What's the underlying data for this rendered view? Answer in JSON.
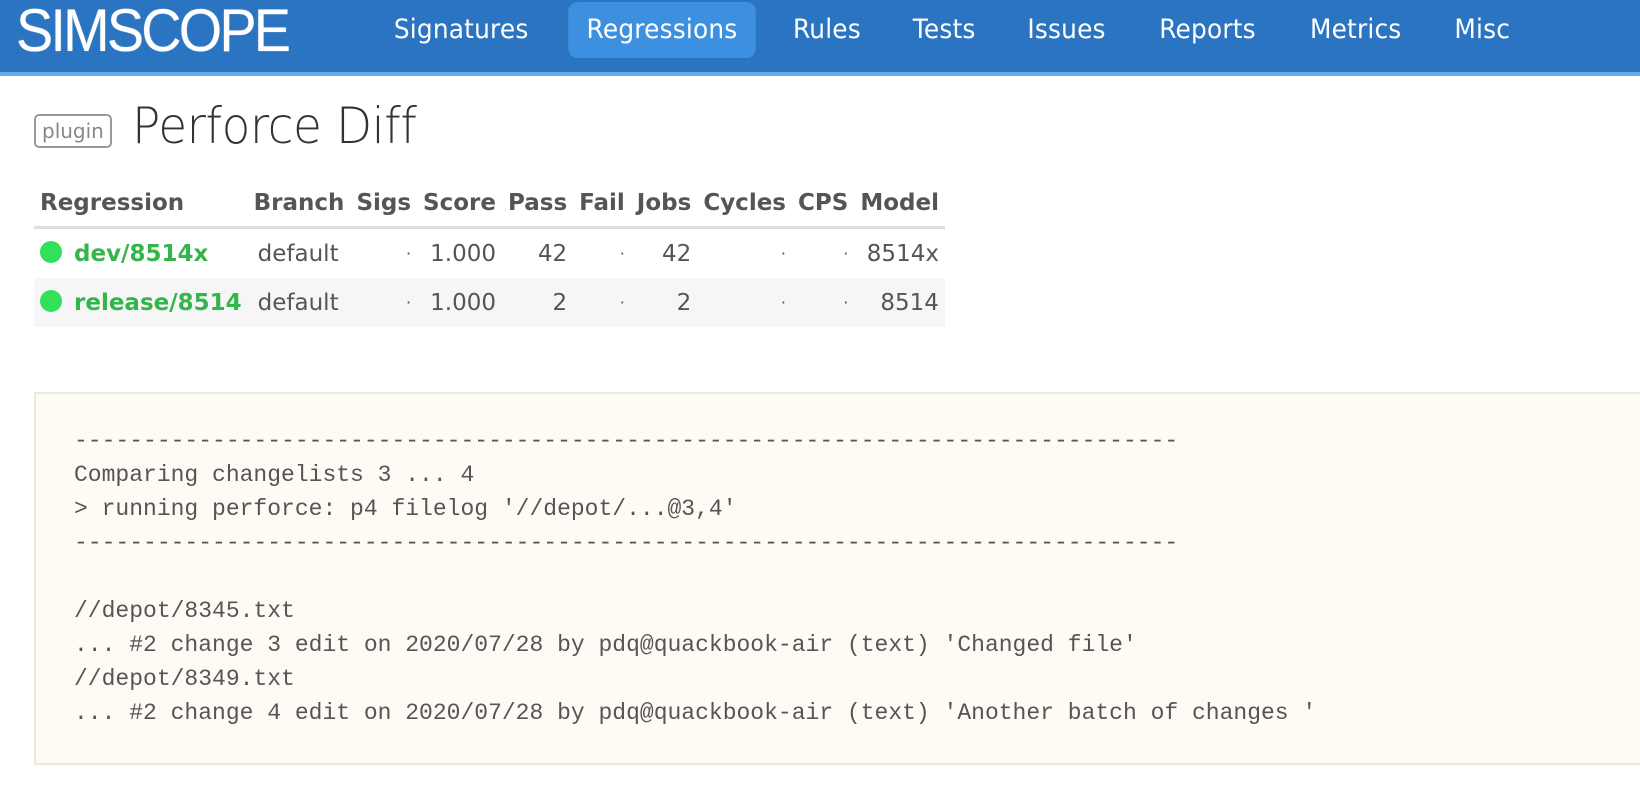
{
  "navbar": {
    "brand": "SIMSCOPE",
    "items": [
      {
        "label": "Signatures",
        "active": false
      },
      {
        "label": "Regressions",
        "active": true
      },
      {
        "label": "Rules",
        "active": false
      },
      {
        "label": "Tests",
        "active": false
      },
      {
        "label": "Issues",
        "active": false
      },
      {
        "label": "Reports",
        "active": false
      },
      {
        "label": "Metrics",
        "active": false
      },
      {
        "label": "Misc",
        "active": false
      }
    ]
  },
  "header": {
    "badge": "plugin",
    "title": "Perforce Diff"
  },
  "table": {
    "columns": [
      "Regression",
      "Branch",
      "Sigs",
      "Score",
      "Pass",
      "Fail",
      "Jobs",
      "Cycles",
      "CPS",
      "Model"
    ],
    "rows": [
      {
        "status": "green",
        "regression": "dev/8514x",
        "branch": "default",
        "sigs": "·",
        "score": "1.000",
        "pass": "42",
        "fail": "·",
        "jobs": "42",
        "cycles": "·",
        "cps": "·",
        "model": "8514x"
      },
      {
        "status": "green",
        "regression": "release/8514",
        "branch": "default",
        "sigs": "·",
        "score": "1.000",
        "pass": "2",
        "fail": "·",
        "jobs": "2",
        "cycles": "·",
        "cps": "·",
        "model": "8514"
      }
    ]
  },
  "output": {
    "lines": [
      "--------------------------------------------------------------------------------",
      "Comparing changelists 3 ... 4",
      "> running perforce: p4 filelog '//depot/...@3,4'",
      "--------------------------------------------------------------------------------",
      "",
      "//depot/8345.txt",
      "... #2 change 3 edit on 2020/07/28 by pdq@quackbook-air (text) 'Changed file'",
      "//depot/8349.txt",
      "... #2 change 4 edit on 2020/07/28 by pdq@quackbook-air (text) 'Another batch of changes '"
    ]
  },
  "colors": {
    "navbar_bg": "#2b74c1",
    "nav_active_bg": "#3d8fe0",
    "success_green": "#33b54a",
    "status_dot_green": "#33e05a",
    "fail_red": "#e05252",
    "output_bg": "#fefbf5"
  }
}
